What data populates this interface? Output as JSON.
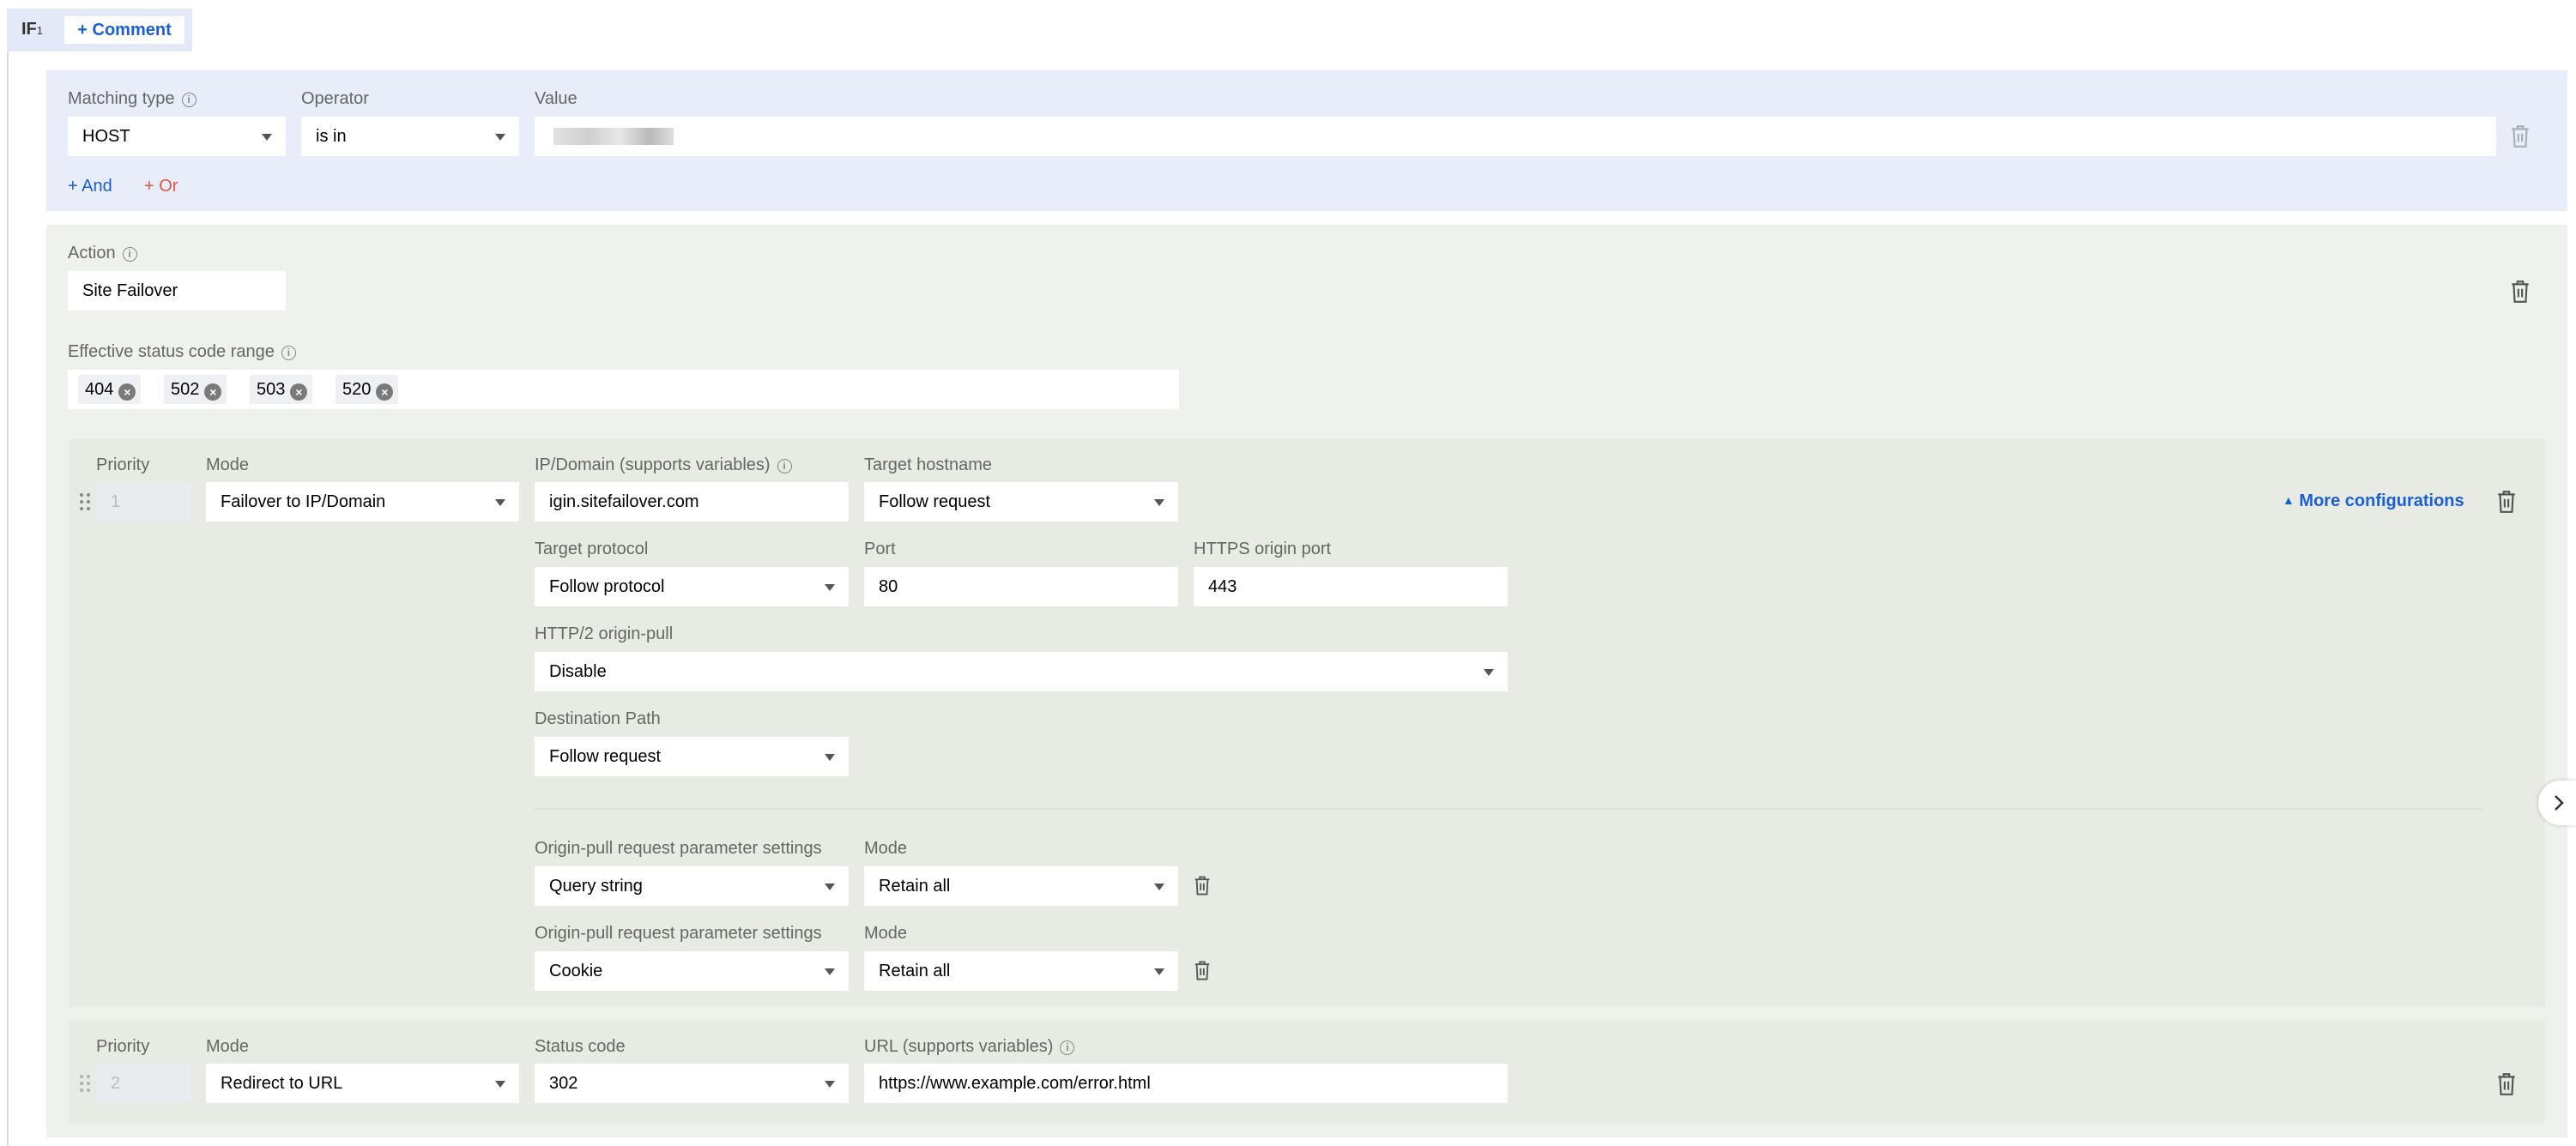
{
  "header": {
    "if_label": "IF",
    "if_index": "1",
    "comment_button": "+ Comment"
  },
  "condition": {
    "matching_type": {
      "label": "Matching type",
      "value": "HOST"
    },
    "operator": {
      "label": "Operator",
      "value": "is in"
    },
    "value": {
      "label": "Value",
      "value": ""
    },
    "and_button": "+ And",
    "or_button": "+ Or"
  },
  "action": {
    "label": "Action",
    "value": "Site Failover",
    "status_range": {
      "label": "Effective status code range",
      "tags": [
        "404",
        "502",
        "503",
        "520"
      ]
    }
  },
  "failover1": {
    "priority_label": "Priority",
    "priority_value": "1",
    "mode_label": "Mode",
    "mode_value": "Failover to IP/Domain",
    "ip_label": "IP/Domain (supports variables)",
    "ip_value": "igin.sitefailover.com",
    "target_host_label": "Target hostname",
    "target_host_value": "Follow request",
    "more_config": "More configurations",
    "protocol_label": "Target protocol",
    "protocol_value": "Follow protocol",
    "port_label": "Port",
    "port_value": "80",
    "https_port_label": "HTTPS origin port",
    "https_port_value": "443",
    "http2_label": "HTTP/2 origin-pull",
    "http2_value": "Disable",
    "dest_path_label": "Destination Path",
    "dest_path_value": "Follow request",
    "params": [
      {
        "label": "Origin-pull request parameter settings",
        "value": "Query string",
        "mode_label": "Mode",
        "mode_value": "Retain all"
      },
      {
        "label": "Origin-pull request parameter settings",
        "value": "Cookie",
        "mode_label": "Mode",
        "mode_value": "Retain all"
      }
    ]
  },
  "failover2": {
    "priority_label": "Priority",
    "priority_value": "2",
    "mode_label": "Mode",
    "mode_value": "Redirect to URL",
    "status_label": "Status code",
    "status_value": "302",
    "url_label": "URL (supports variables)",
    "url_value": "https://www.example.com/error.html"
  },
  "colors": {
    "condition_bg": "#e9edf9",
    "action_bg": "#eff2ec",
    "failover_bg": "#e8ebe4",
    "link_blue": "#1a5fd6",
    "link_red": "#e0573c"
  },
  "icons": [
    "info-icon",
    "chevron-down-icon",
    "trash-icon",
    "drag-handle-icon",
    "close-circle-icon",
    "caret-up-icon",
    "chevron-right-icon"
  ]
}
